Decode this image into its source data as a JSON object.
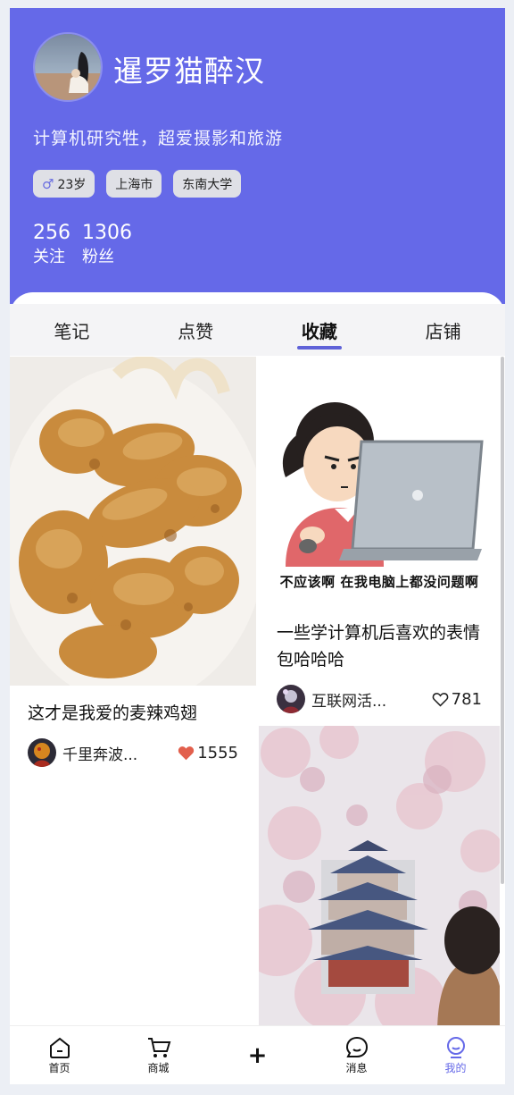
{
  "profile": {
    "name": "暹罗猫醉汉",
    "bio": "计算机研究牲，超爱摄影和旅游",
    "tags": {
      "gender_icon": "male-icon",
      "age": "23岁",
      "city": "上海市",
      "school": "东南大学"
    },
    "stats": {
      "following_count": "256",
      "following_label": "关注",
      "followers_count": "1306",
      "followers_label": "粉丝"
    }
  },
  "tabs": [
    "笔记",
    "点赞",
    "收藏",
    "店铺"
  ],
  "active_tab": "收藏",
  "posts": [
    {
      "title": "这才是我爱的麦辣鸡翅",
      "author": "千里奔波...",
      "likes": "1555",
      "liked": true
    },
    {
      "caption": "不应该啊 在我电脑上都没问题啊",
      "title": "一些学计算机后喜欢的表情包哈哈哈",
      "author": "互联网活...",
      "likes": "781",
      "liked": false
    },
    {
      "title": "",
      "author": "",
      "likes": ""
    }
  ],
  "nav": [
    {
      "label": "首页",
      "icon": "home-icon"
    },
    {
      "label": "商城",
      "icon": "cart-icon"
    },
    {
      "label": "+",
      "icon": "plus-icon"
    },
    {
      "label": "消息",
      "icon": "message-icon"
    },
    {
      "label": "我的",
      "icon": "profile-icon",
      "active": true
    }
  ],
  "colors": {
    "accent": "#6569e8",
    "like": "#e25f4c",
    "tag_bg": "#dfe0e6"
  }
}
